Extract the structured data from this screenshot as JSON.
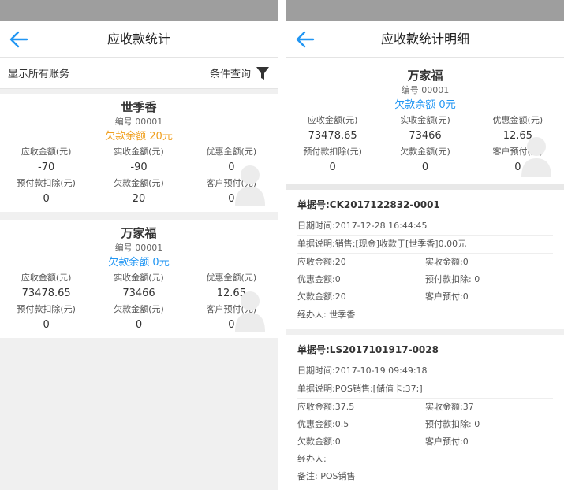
{
  "left": {
    "title": "应收款统计",
    "filter_left": "显示所有账务",
    "filter_right": "条件查询",
    "cards": [
      {
        "name": "世季香",
        "code": "编号 00001",
        "balance": "欠款余额 20元",
        "balance_color": "#f0a020",
        "row1_labels": [
          "应收金额(元)",
          "实收金额(元)",
          "优惠金额(元)"
        ],
        "row1_values": [
          "-70",
          "-90",
          "0"
        ],
        "row2_labels": [
          "预付款扣除(元)",
          "欠款金额(元)",
          "客户预付(元)"
        ],
        "row2_values": [
          "0",
          "20",
          "0"
        ]
      },
      {
        "name": "万家福",
        "code": "编号 00001",
        "balance": "欠款余额 0元",
        "balance_color": "#2196f3",
        "row1_labels": [
          "应收金额(元)",
          "实收金额(元)",
          "优惠金额(元)"
        ],
        "row1_values": [
          "73478.65",
          "73466",
          "12.65"
        ],
        "row2_labels": [
          "预付款扣除(元)",
          "欠款金额(元)",
          "客户预付(元)"
        ],
        "row2_values": [
          "0",
          "0",
          "0"
        ]
      }
    ]
  },
  "right": {
    "title": "应收款统计明细",
    "summary": {
      "name": "万家福",
      "code": "编号 00001",
      "balance": "欠款余额 0元",
      "balance_color": "#2196f3",
      "row1_labels": [
        "应收金额(元)",
        "实收金额(元)",
        "优惠金额(元)"
      ],
      "row1_values": [
        "73478.65",
        "73466",
        "12.65"
      ],
      "row2_labels": [
        "预付款扣除(元)",
        "欠款金额(元)",
        "客户预付(元)"
      ],
      "row2_values": [
        "0",
        "0",
        "0"
      ]
    },
    "docs": [
      {
        "docno": "单据号:CK2017122832-0001",
        "datetime": "日期时间:2017-12-28 16:44:45",
        "desc": "单据说明:销售:[现金]收款于[世季香]0.00元",
        "pairs": [
          [
            "应收金额:20",
            "实收金额:0"
          ],
          [
            "优惠金额:0",
            "预付款扣除: 0"
          ],
          [
            "欠款金额:20",
            "客户预付:0"
          ]
        ],
        "handler": "经办人: 世季香",
        "note": ""
      },
      {
        "docno": "单据号:LS2017101917-0028",
        "datetime": "日期时间:2017-10-19 09:49:18",
        "desc": "单据说明:POS销售:[储值卡:37;]",
        "pairs": [
          [
            "应收金额:37.5",
            "实收金额:37"
          ],
          [
            "优惠金额:0.5",
            "预付款扣除: 0"
          ],
          [
            "欠款金额:0",
            "客户预付:0"
          ]
        ],
        "handler": "经办人:",
        "note": "备注: POS销售"
      }
    ]
  },
  "icons": {
    "back": "arrow-left-icon",
    "filter": "funnel-icon",
    "avatar": "user-silhouette-icon"
  },
  "colors": {
    "accent_blue": "#2196f3",
    "warning_orange": "#f0a020",
    "statusbar": "#9e9e9e"
  }
}
